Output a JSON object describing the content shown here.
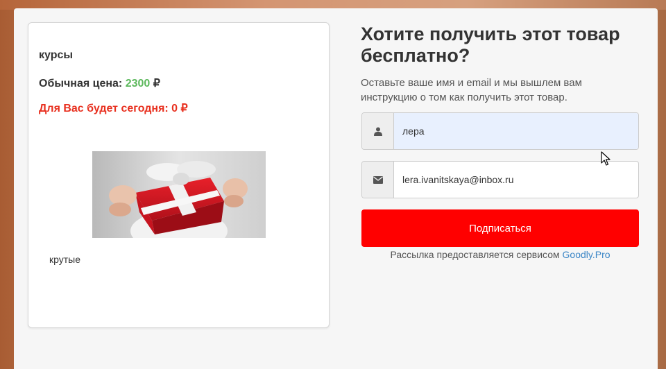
{
  "product": {
    "title": "курсы",
    "regular_price_label": "Обычная цена:",
    "regular_price_value": "2300",
    "currency": "₽",
    "today_label": "Для Вас будет сегодня: 0 ₽",
    "description": "крутые",
    "image_icon": "gift-box-image"
  },
  "offer": {
    "headline": "Хотите получить этот товар бесплатно?",
    "subtext": "Оставьте ваше имя и email и мы вышлем вам инструкцию о том как получить этот товар."
  },
  "form": {
    "name_value": "лера",
    "name_icon": "user-icon",
    "email_value": "lera.ivanitskaya@inbox.ru",
    "email_icon": "envelope-icon",
    "submit_label": "Подписаться",
    "service_text": "Рассылка предоставляется сервисом",
    "service_link": "Goodly.Pro"
  },
  "colors": {
    "accent_red": "#ff0000",
    "price_green": "#5cb85c",
    "today_red": "#e8301f",
    "link_blue": "#3b86c6"
  }
}
